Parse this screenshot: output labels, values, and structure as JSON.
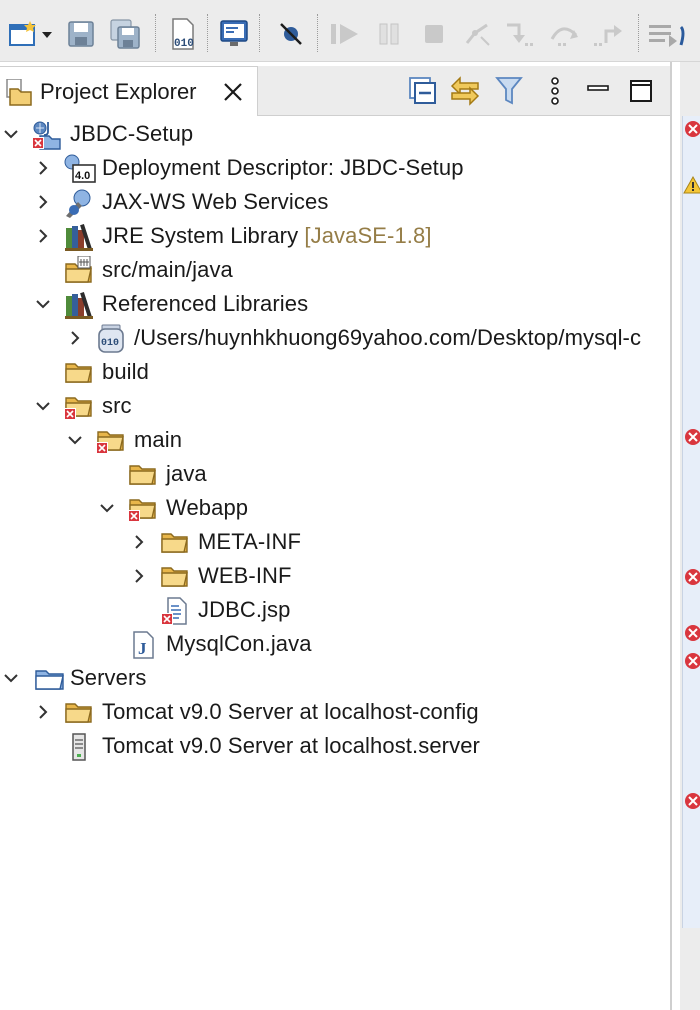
{
  "toolbar": {
    "buttons": [
      "new-wizard",
      "save",
      "save-all",
      "open-type",
      "open-console",
      "skip-breakpoints",
      "resume",
      "suspend",
      "terminate",
      "disconnect",
      "step-into",
      "step-over",
      "step-return",
      "use-step-filters"
    ]
  },
  "view": {
    "title": "Project Explorer",
    "close_icon": "close-icon"
  },
  "tree": {
    "rows": [
      {
        "label": "JBDC-Setup",
        "decor": "",
        "icon": "project-icon",
        "expanded": true
      },
      {
        "label": "Deployment Descriptor: JBDC-Setup",
        "decor": "",
        "icon": "deployment-descriptor-icon",
        "expanded": false
      },
      {
        "label": "JAX-WS Web Services",
        "decor": "",
        "icon": "web-services-icon",
        "expanded": false
      },
      {
        "label": "JRE System Library",
        "decor": "[JavaSE-1.8]",
        "icon": "library-icon",
        "expanded": false
      },
      {
        "label": "src/main/java",
        "decor": "",
        "icon": "source-folder-icon",
        "expanded": null
      },
      {
        "label": "Referenced Libraries",
        "decor": "",
        "icon": "library-icon",
        "expanded": true
      },
      {
        "label": "/Users/huynhkhuong69yahoo.com/Desktop/mysql-c",
        "decor": "",
        "icon": "jar-icon",
        "expanded": false
      },
      {
        "label": "build",
        "decor": "",
        "icon": "folder-icon",
        "expanded": null
      },
      {
        "label": "src",
        "decor": "",
        "icon": "folder-error-icon",
        "expanded": true
      },
      {
        "label": "main",
        "decor": "",
        "icon": "folder-error-icon",
        "expanded": true
      },
      {
        "label": "java",
        "decor": "",
        "icon": "folder-icon",
        "expanded": null
      },
      {
        "label": "Webapp",
        "decor": "",
        "icon": "folder-error-icon",
        "expanded": true
      },
      {
        "label": "META-INF",
        "decor": "",
        "icon": "folder-icon",
        "expanded": false
      },
      {
        "label": "WEB-INF",
        "decor": "",
        "icon": "folder-icon",
        "expanded": false
      },
      {
        "label": "JDBC.jsp",
        "decor": "",
        "icon": "jsp-file-error-icon",
        "expanded": null
      },
      {
        "label": "MysqlCon.java",
        "decor": "",
        "icon": "java-file-icon",
        "expanded": null
      },
      {
        "label": "Servers",
        "decor": "",
        "icon": "servers-project-icon",
        "expanded": true
      },
      {
        "label": "Tomcat v9.0 Server at localhost-config",
        "decor": "",
        "icon": "folder-icon",
        "expanded": false
      },
      {
        "label": "Tomcat v9.0 Server at localhost.server",
        "decor": "",
        "icon": "server-file-icon",
        "expanded": null
      }
    ]
  },
  "colors": {
    "decoration": "#957d47",
    "error": "#d9363e",
    "folder": "#e8b64a"
  }
}
